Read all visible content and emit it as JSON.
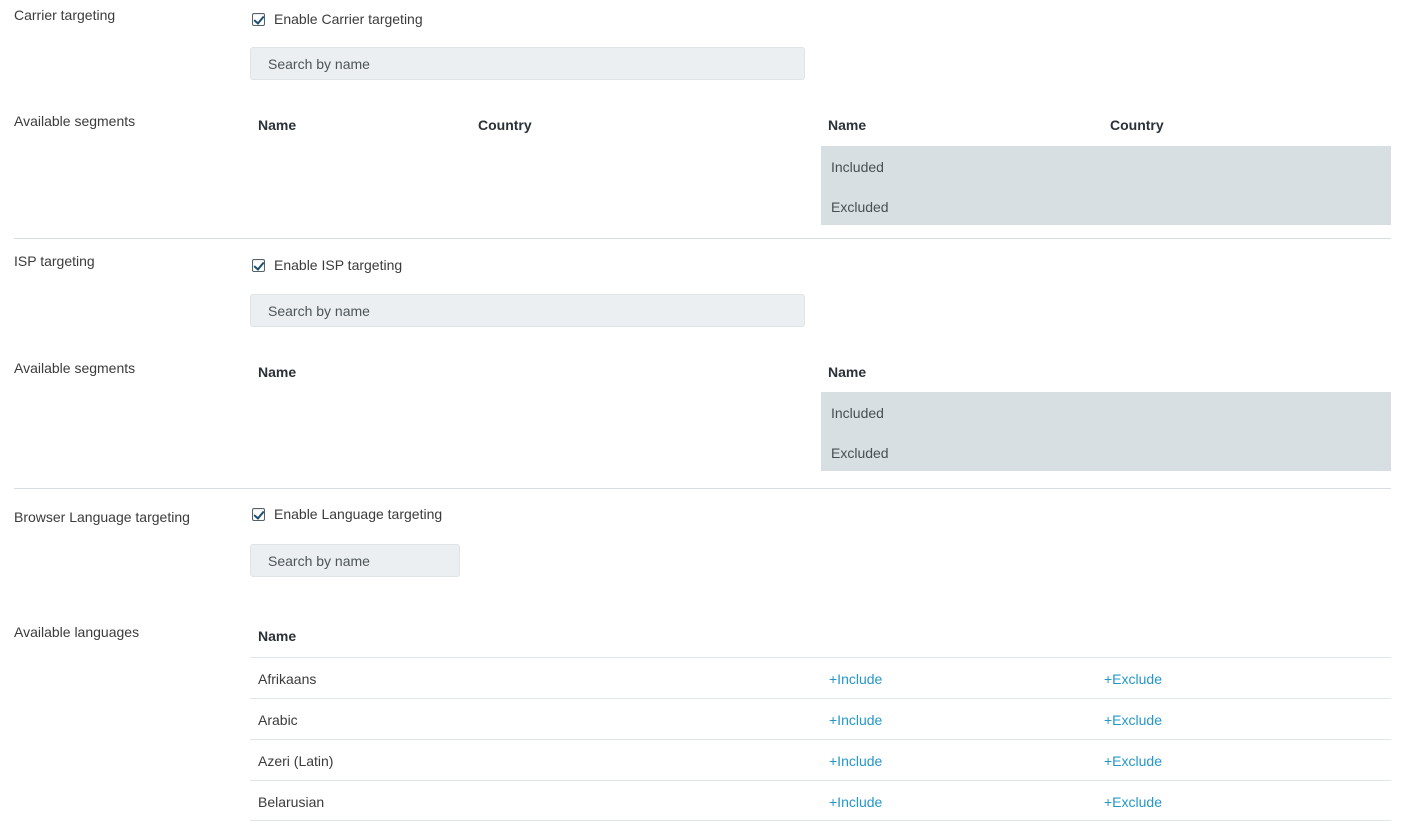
{
  "sections": [
    {
      "id": "carrier",
      "label": "Carrier targeting",
      "checkbox_label": "Enable Carrier targeting",
      "checked": true,
      "search_placeholder": "Search by name",
      "segments_label": "Available segments",
      "available_headers": [
        "Name",
        "Country"
      ],
      "selected_headers": [
        "Name",
        "Country"
      ],
      "selected_groups": [
        "Included",
        "Excluded"
      ]
    },
    {
      "id": "isp",
      "label": "ISP targeting",
      "checkbox_label": "Enable ISP targeting",
      "checked": true,
      "search_placeholder": "Search by name",
      "segments_label": "Available segments",
      "available_headers": [
        "Name"
      ],
      "selected_headers": [
        "Name"
      ],
      "selected_groups": [
        "Included",
        "Excluded"
      ]
    },
    {
      "id": "language",
      "label": "Browser Language targeting",
      "checkbox_label": "Enable Language targeting",
      "checked": true,
      "search_placeholder": "Search by name",
      "segments_label": "Available languages",
      "available_headers": [
        "Name"
      ]
    }
  ],
  "language_table": {
    "header": "Name",
    "include_label": "+Include",
    "exclude_label": "+Exclude",
    "rows": [
      {
        "name": "Afrikaans"
      },
      {
        "name": "Arabic"
      },
      {
        "name": "Azeri (Latin)"
      },
      {
        "name": "Belarusian"
      }
    ]
  },
  "colors": {
    "link": "#2497c9",
    "panel_bg": "#d7dfe2",
    "input_bg": "#eceff1",
    "divider": "#d5dde3",
    "text": "#3b3b3b"
  }
}
